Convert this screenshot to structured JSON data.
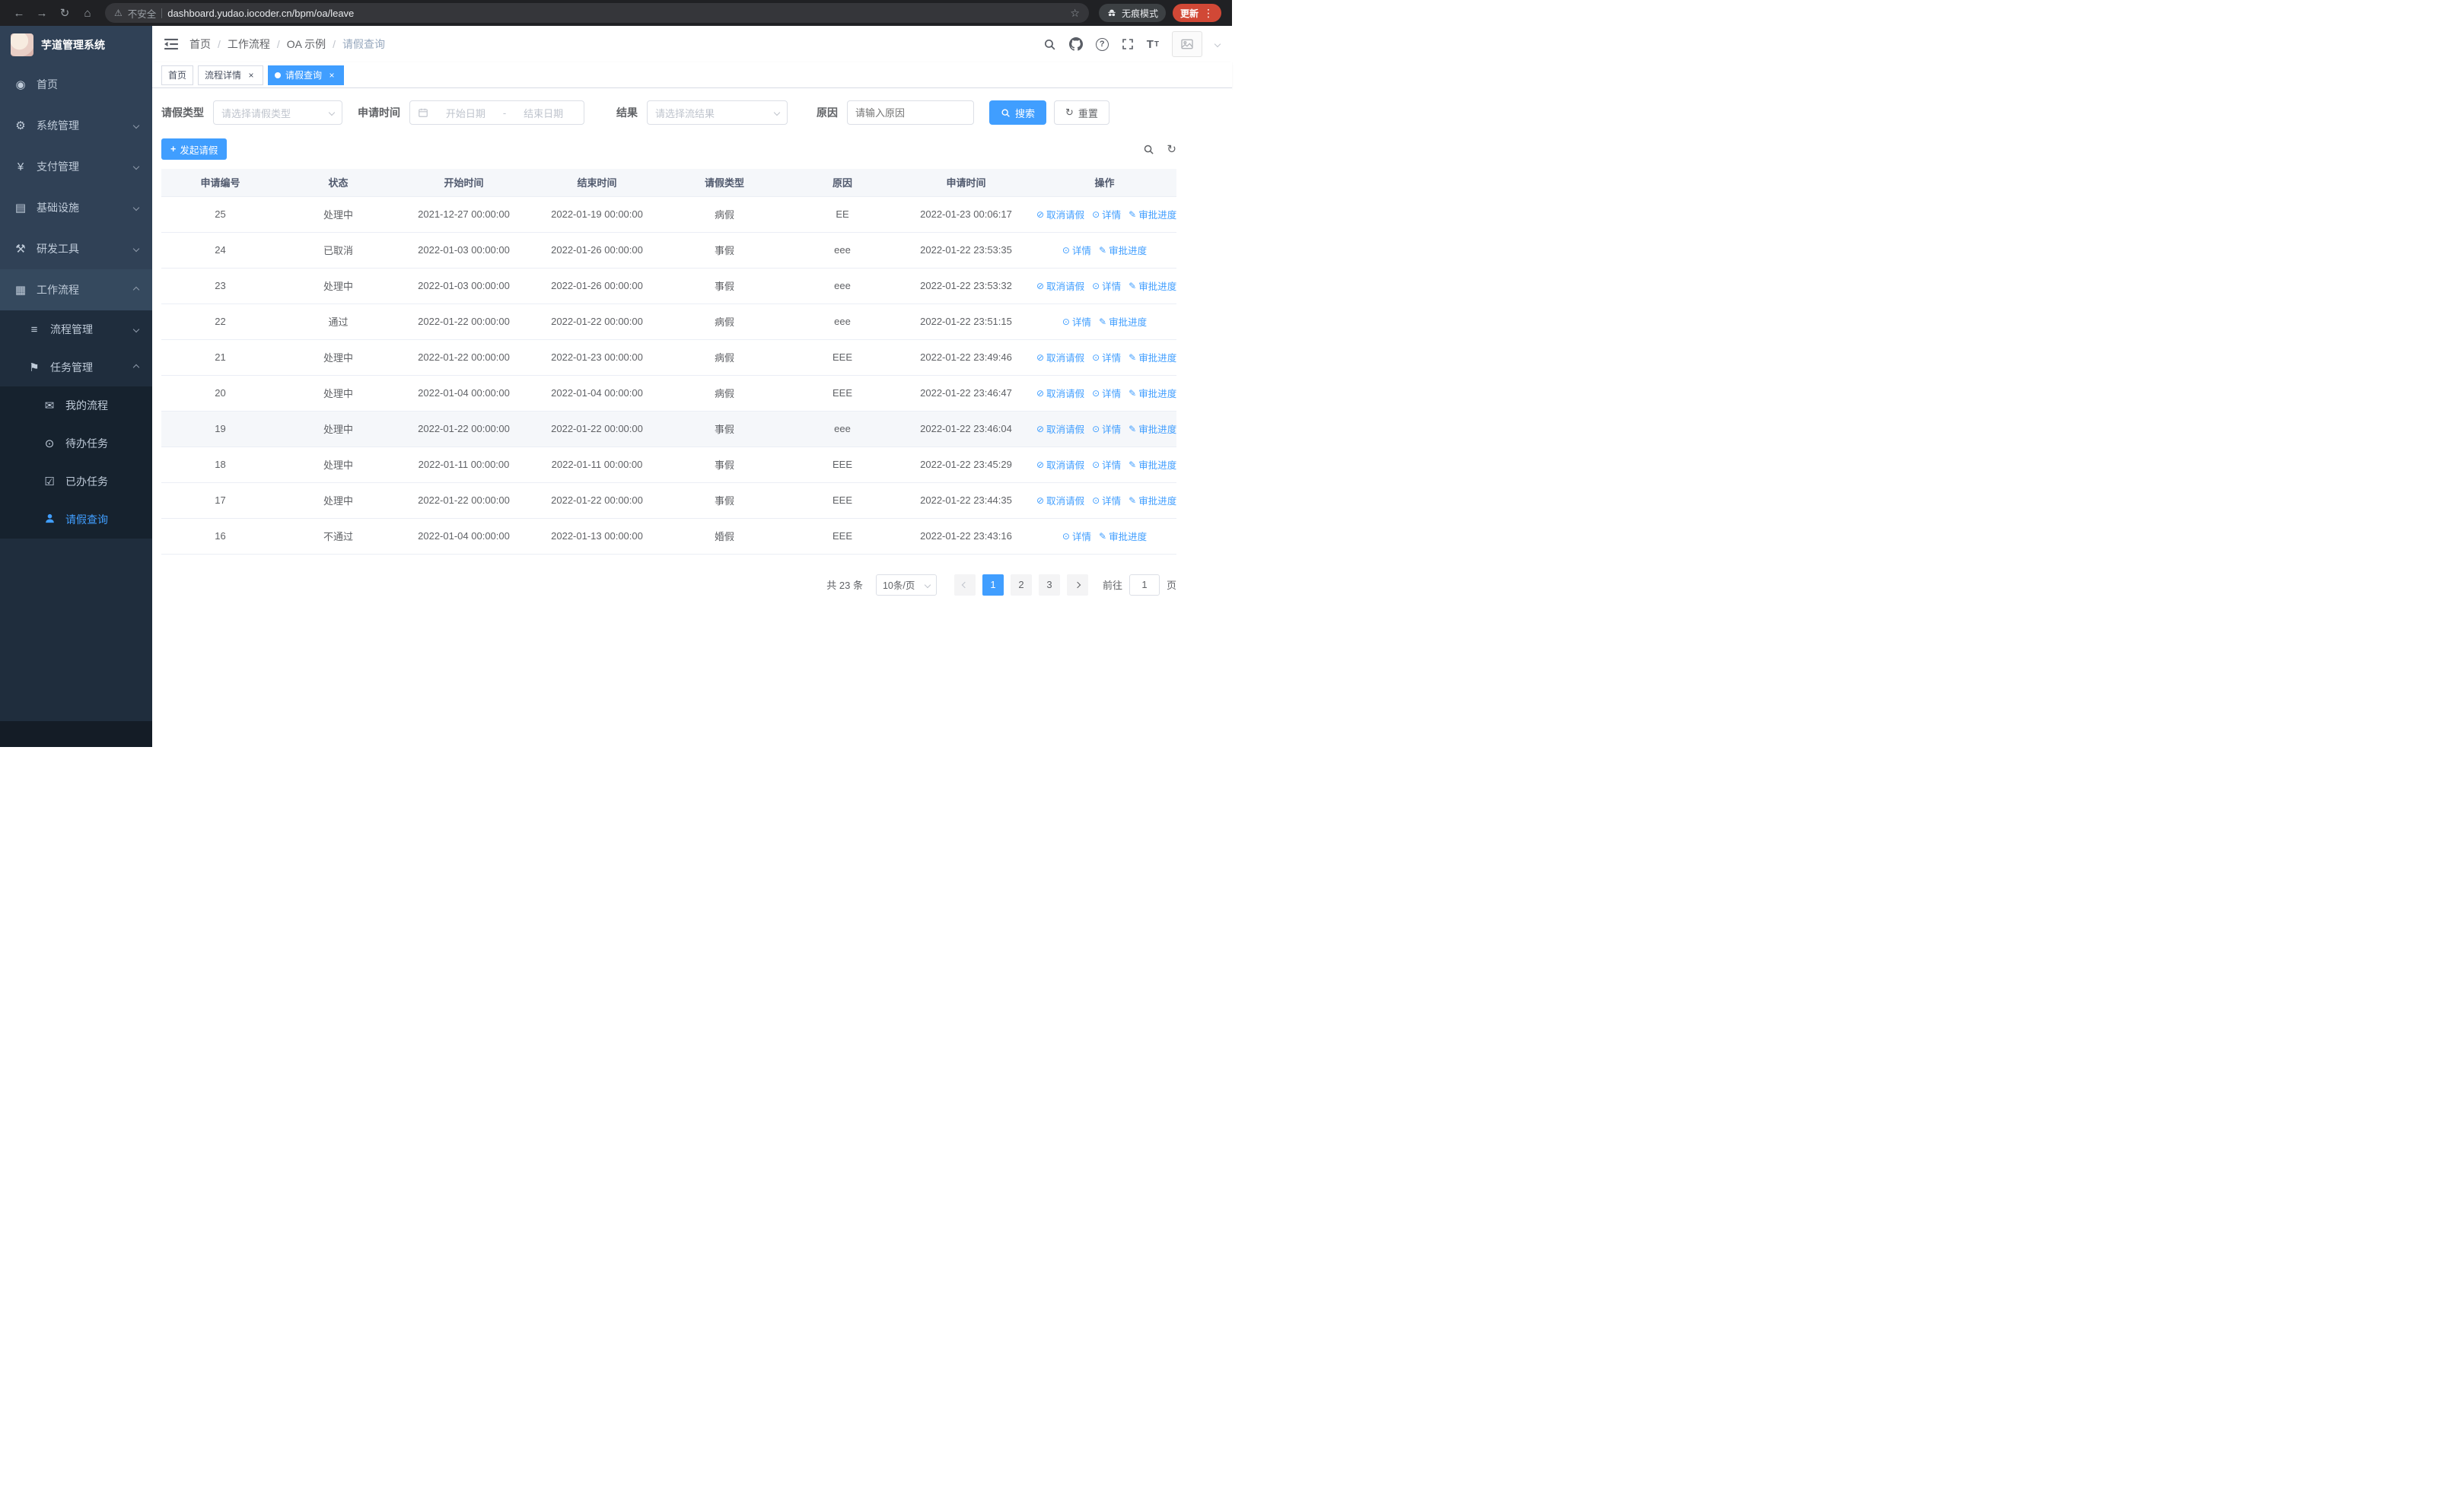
{
  "browser": {
    "warning": "不安全",
    "url": "dashboard.yudao.iocoder.cn/bpm/oa/leave",
    "incognito": "无痕模式",
    "update": "更新"
  },
  "sidebar": {
    "title": "芋道管理系统",
    "items": [
      {
        "label": "首页"
      },
      {
        "label": "系统管理"
      },
      {
        "label": "支付管理"
      },
      {
        "label": "基础设施"
      },
      {
        "label": "研发工具"
      },
      {
        "label": "工作流程"
      }
    ],
    "submenu": {
      "process": "流程管理",
      "task": "任务管理",
      "task_children": [
        {
          "label": "我的流程"
        },
        {
          "label": "待办任务"
        },
        {
          "label": "已办任务"
        },
        {
          "label": "请假查询"
        }
      ]
    }
  },
  "breadcrumb": {
    "items": [
      {
        "label": "首页"
      },
      {
        "label": "工作流程"
      },
      {
        "label": "OA 示例"
      },
      {
        "label": "请假查询"
      }
    ]
  },
  "tabs": {
    "items": [
      {
        "label": "首页"
      },
      {
        "label": "流程详情"
      },
      {
        "label": "请假查询"
      }
    ]
  },
  "filters": {
    "leave_type_label": "请假类型",
    "leave_type_placeholder": "请选择请假类型",
    "apply_time_label": "申请时间",
    "start_date_placeholder": "开始日期",
    "range_separator": "-",
    "end_date_placeholder": "结束日期",
    "result_label": "结果",
    "result_placeholder": "请选择流结果",
    "reason_label": "原因",
    "reason_placeholder": "请输入原因",
    "search_button": "搜索",
    "reset_button": "重置"
  },
  "toolbar": {
    "create_button": "发起请假"
  },
  "table": {
    "columns": [
      "申请编号",
      "状态",
      "开始时间",
      "结束时间",
      "请假类型",
      "原因",
      "申请时间",
      "操作"
    ],
    "actions": {
      "cancel": "取消请假",
      "detail": "详情",
      "progress": "审批进度"
    },
    "rows": [
      {
        "id": "25",
        "status": "处理中",
        "start": "2021-12-27 00:00:00",
        "end": "2022-01-19 00:00:00",
        "type": "病假",
        "reason": "EE",
        "applied": "2022-01-23 00:06:17",
        "can_cancel": true
      },
      {
        "id": "24",
        "status": "已取消",
        "start": "2022-01-03 00:00:00",
        "end": "2022-01-26 00:00:00",
        "type": "事假",
        "reason": "eee",
        "applied": "2022-01-22 23:53:35",
        "can_cancel": false
      },
      {
        "id": "23",
        "status": "处理中",
        "start": "2022-01-03 00:00:00",
        "end": "2022-01-26 00:00:00",
        "type": "事假",
        "reason": "eee",
        "applied": "2022-01-22 23:53:32",
        "can_cancel": true
      },
      {
        "id": "22",
        "status": "通过",
        "start": "2022-01-22 00:00:00",
        "end": "2022-01-22 00:00:00",
        "type": "病假",
        "reason": "eee",
        "applied": "2022-01-22 23:51:15",
        "can_cancel": false
      },
      {
        "id": "21",
        "status": "处理中",
        "start": "2022-01-22 00:00:00",
        "end": "2022-01-23 00:00:00",
        "type": "病假",
        "reason": "EEE",
        "applied": "2022-01-22 23:49:46",
        "can_cancel": true
      },
      {
        "id": "20",
        "status": "处理中",
        "start": "2022-01-04 00:00:00",
        "end": "2022-01-04 00:00:00",
        "type": "病假",
        "reason": "EEE",
        "applied": "2022-01-22 23:46:47",
        "can_cancel": true
      },
      {
        "id": "19",
        "status": "处理中",
        "start": "2022-01-22 00:00:00",
        "end": "2022-01-22 00:00:00",
        "type": "事假",
        "reason": "eee",
        "applied": "2022-01-22 23:46:04",
        "can_cancel": true,
        "hover": true
      },
      {
        "id": "18",
        "status": "处理中",
        "start": "2022-01-11 00:00:00",
        "end": "2022-01-11 00:00:00",
        "type": "事假",
        "reason": "EEE",
        "applied": "2022-01-22 23:45:29",
        "can_cancel": true
      },
      {
        "id": "17",
        "status": "处理中",
        "start": "2022-01-22 00:00:00",
        "end": "2022-01-22 00:00:00",
        "type": "事假",
        "reason": "EEE",
        "applied": "2022-01-22 23:44:35",
        "can_cancel": true
      },
      {
        "id": "16",
        "status": "不通过",
        "start": "2022-01-04 00:00:00",
        "end": "2022-01-13 00:00:00",
        "type": "婚假",
        "reason": "EEE",
        "applied": "2022-01-22 23:43:16",
        "can_cancel": false
      }
    ]
  },
  "pagination": {
    "total": "共 23 条",
    "page_size": "10条/页",
    "pages": [
      "1",
      "2",
      "3"
    ],
    "active_page": "1",
    "goto_label": "前往",
    "goto_value": "1",
    "goto_suffix": "页"
  },
  "colors": {
    "accent": "#409eff",
    "sidebar_bg": "#304156",
    "submenu_bg": "#1f2d3d"
  }
}
